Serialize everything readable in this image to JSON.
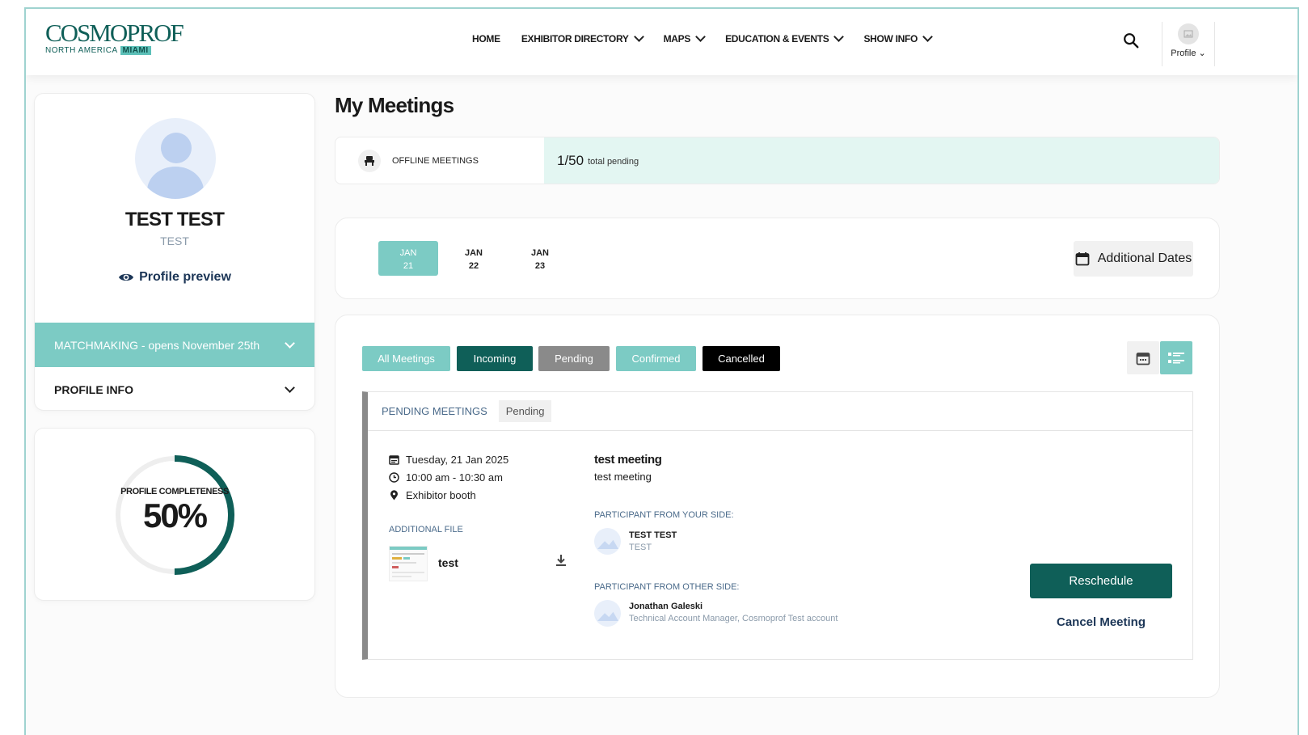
{
  "header": {
    "logo_main": "COSMOPROF",
    "logo_region": "NORTH AMERICA",
    "logo_city": "MIAMI",
    "nav": [
      {
        "label": "HOME"
      },
      {
        "label": "EXHIBITOR DIRECTORY"
      },
      {
        "label": "MAPS"
      },
      {
        "label": "EDUCATION & EVENTS"
      },
      {
        "label": "SHOW INFO"
      }
    ],
    "profile_label": "Profile"
  },
  "profile": {
    "name": "TEST TEST",
    "subtitle": "TEST",
    "preview_link": "Profile preview",
    "matchmaking": "MATCHMAKING - opens November 25th",
    "profile_info": "PROFILE INFO"
  },
  "completeness": {
    "label": "PROFILE COMPLETENESS",
    "value_text": "50%",
    "fraction": 0.5
  },
  "main": {
    "title": "My Meetings",
    "offline_label": "OFFLINE MEETINGS",
    "pending_count": "1/50",
    "pending_text": "total pending"
  },
  "dates": {
    "tabs": [
      {
        "month": "JAN",
        "day": "21",
        "active": true
      },
      {
        "month": "JAN",
        "day": "22",
        "active": false
      },
      {
        "month": "JAN",
        "day": "23",
        "active": false
      }
    ],
    "additional": "Additional Dates"
  },
  "filters": [
    {
      "label": "All Meetings",
      "color": "#7ccbc4"
    },
    {
      "label": "Incoming",
      "color": "#0f5f58"
    },
    {
      "label": "Pending",
      "color": "#8a8a8a"
    },
    {
      "label": "Confirmed",
      "color": "#7ccbc4"
    },
    {
      "label": "Cancelled",
      "color": "#000000"
    }
  ],
  "view_icons": [
    "calendar-icon",
    "list-icon"
  ],
  "meeting": {
    "section_title": "PENDING MEETINGS",
    "status": "Pending",
    "date": "Tuesday, 21 Jan 2025",
    "time": "10:00 am - 10:30 am",
    "location": "Exhibitor booth",
    "additional_file_label": "ADDITIONAL FILE",
    "file_name": "test",
    "title": "test meeting",
    "description": "test meeting",
    "your_side_label": "PARTICIPANT FROM YOUR SIDE:",
    "your_name": "TEST TEST",
    "your_sub": "TEST",
    "other_side_label": "PARTICIPANT FROM OTHER SIDE:",
    "other_name": "Jonathan Galeski",
    "other_sub": "Technical Account Manager, Cosmoprof Test account",
    "reschedule": "Reschedule",
    "cancel": "Cancel Meeting"
  },
  "colors": {
    "brand": "#0f5f58",
    "accent": "#7ccbc4",
    "pending_bg": "#e3f6f2"
  }
}
